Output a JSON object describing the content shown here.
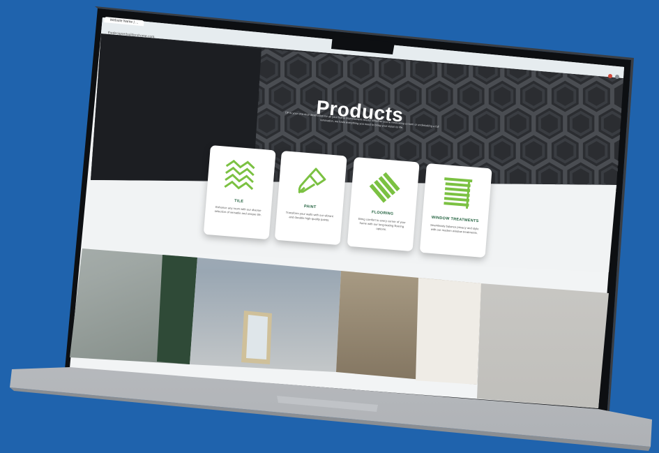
{
  "browser": {
    "tab_label": "Website Name | ...",
    "url": "thedesignerbuildershome.com"
  },
  "hero": {
    "title": "Products",
    "intro": "DF is your one-stop destination for all your home improvement needs! Whether you're renovating a room or undertaking a full renovation, we have everything you need to bring your vision to life."
  },
  "cards": [
    {
      "title": "TILE",
      "desc": "Enhance any room with our diverse selection of versatile and unique tile.",
      "icon": "tile-chevron-icon"
    },
    {
      "title": "PAINT",
      "desc": "Transform your walls with our vibrant and durable high-quality paints.",
      "icon": "paint-brush-icon"
    },
    {
      "title": "FLOORING",
      "desc": "Bring comfort to every corner of your home with our long-lasting flooring options.",
      "icon": "flooring-planks-icon"
    },
    {
      "title": "WINDOW TREATMENTS",
      "desc": "Seamlessly balance privacy and style with our modern window treatments.",
      "icon": "window-blinds-icon"
    }
  ],
  "colors": {
    "background": "#1f63ad",
    "accent_green": "#7bc142",
    "card_title": "#1f5f3c",
    "hero_dark": "#2b2d31"
  }
}
